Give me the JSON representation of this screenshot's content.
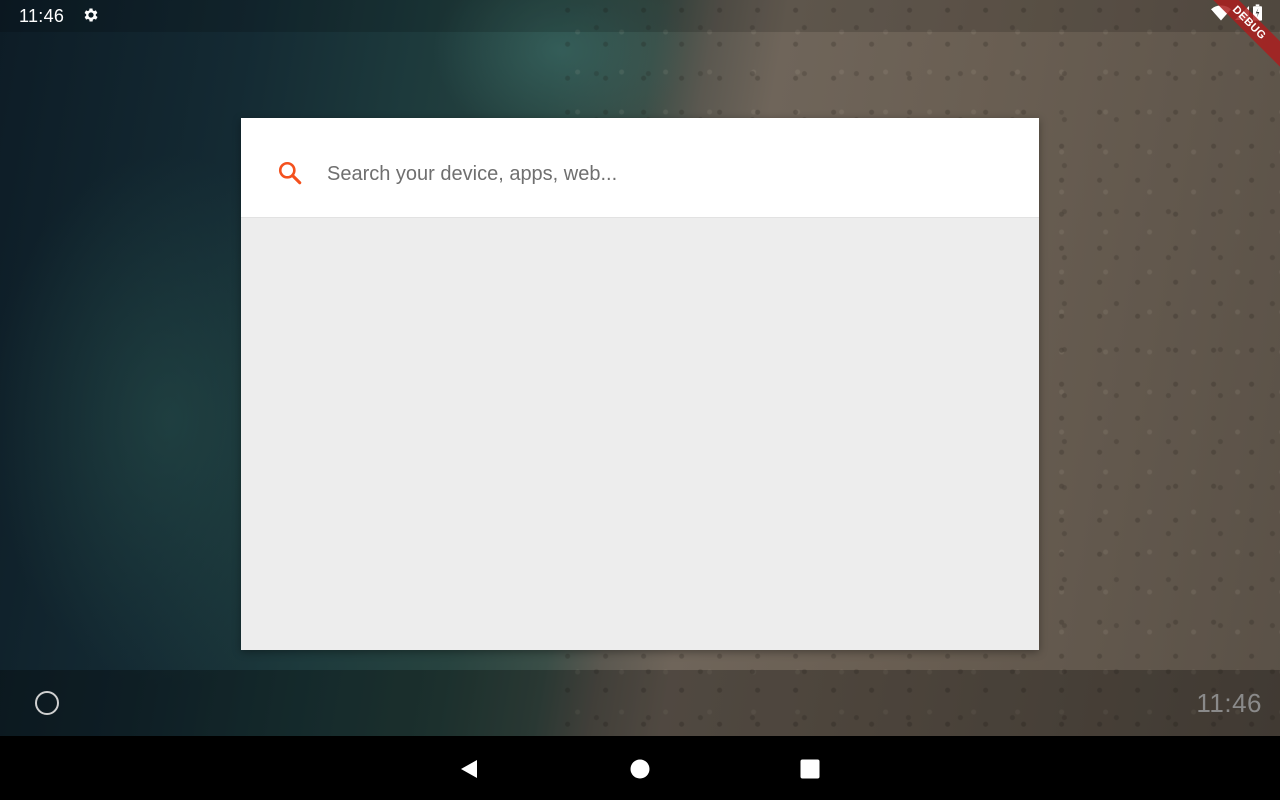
{
  "status_bar": {
    "time": "11:46",
    "icons": [
      "gear-icon",
      "wifi-icon",
      "cell-signal-icon",
      "battery-icon"
    ]
  },
  "debug_banner": {
    "label": "DEBUG"
  },
  "search": {
    "placeholder": "Search your device, apps, web...",
    "value": "",
    "accent_color": "#f4511e"
  },
  "dock": {
    "time": "11:46"
  },
  "nav_bar": {
    "buttons": [
      "back-icon",
      "home-icon",
      "recents-icon"
    ]
  }
}
